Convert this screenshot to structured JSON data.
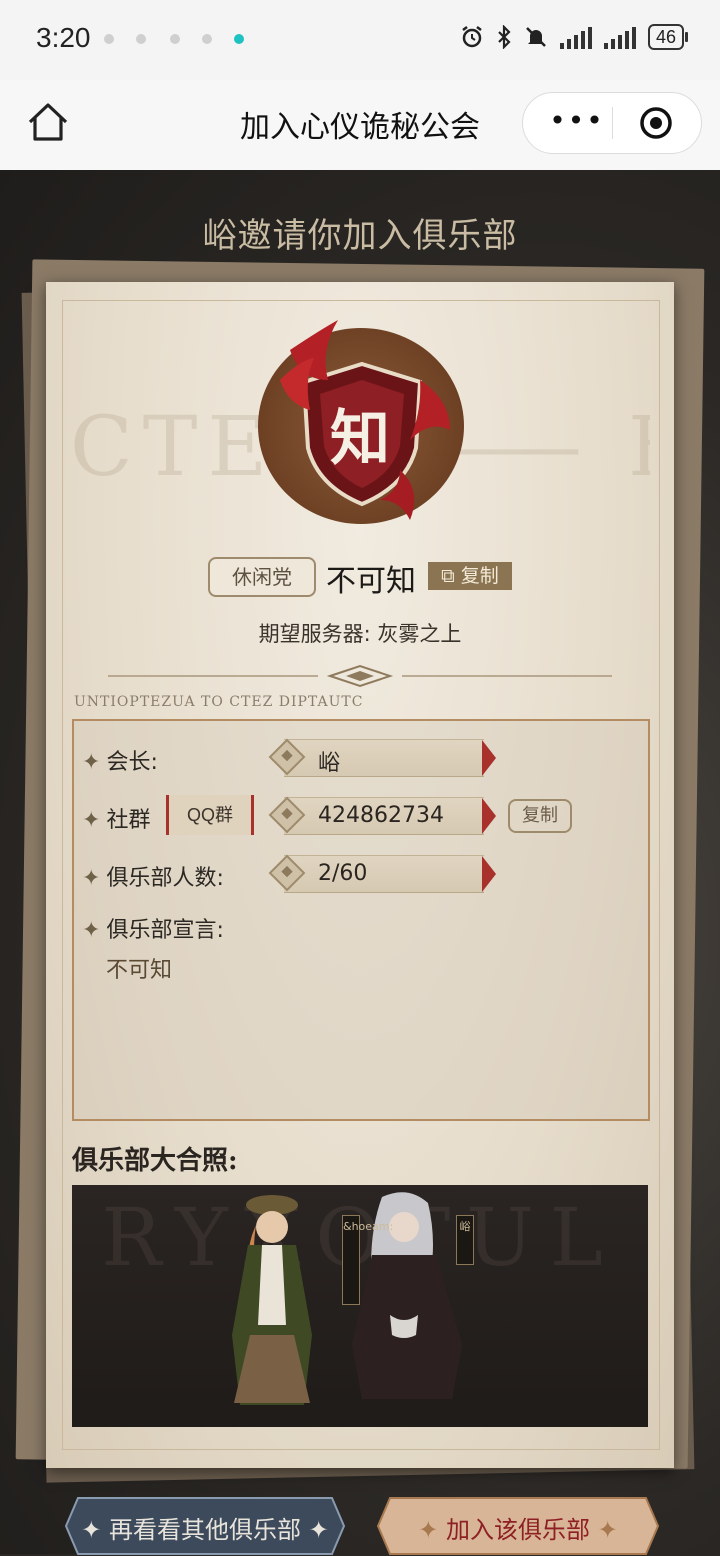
{
  "status_bar": {
    "time": "3:20",
    "battery": "46",
    "icons": [
      "alarm-icon",
      "bluetooth-icon",
      "mute-icon",
      "signal-icon",
      "signal-icon",
      "battery-icon"
    ]
  },
  "navbar": {
    "title": "加入心仪诡秘公会",
    "more_label": "•••"
  },
  "invite": {
    "title": "峪邀请你加入俱乐部"
  },
  "club": {
    "emblem_char": "知",
    "tag": "休闲党",
    "name": "不可知",
    "copy_label": "复制",
    "server_label": "期望服务器: 灰雾之上",
    "script_text": "UNTIOPTEZUA TO CTEZ DIPTAUTC",
    "bg_letters": "CTEZ ⸻ FUTD"
  },
  "info": {
    "leader_label": "会长:",
    "leader_value": "峪",
    "group_label": "社群",
    "group_type": "QQ群",
    "group_value": "424862734",
    "group_copy": "复制",
    "members_label": "俱乐部人数:",
    "members_value": "2/60",
    "declaration_label": "俱乐部宣言:",
    "declaration_value": "不可知"
  },
  "photo": {
    "title": "俱乐部大合照:",
    "bg_letters": "RYXOTUL",
    "member1_name": "&hoeam:",
    "member2_name": "峪"
  },
  "buttons": {
    "browse_label": "再看看其他俱乐部",
    "join_label": "加入该俱乐部"
  },
  "colors": {
    "accent_red": "#a8312c",
    "paper": "#e6dccb",
    "gold": "#8b7452"
  }
}
